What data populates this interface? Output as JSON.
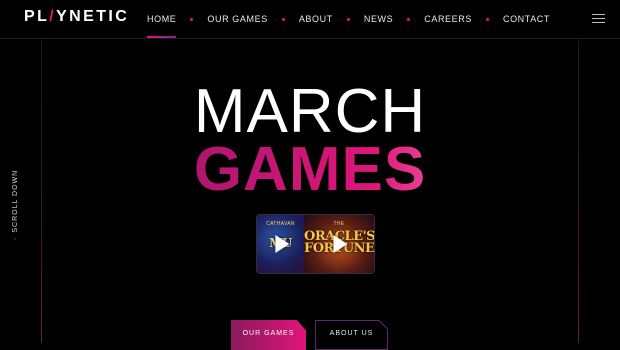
{
  "brand": {
    "logo_before": "PL",
    "logo_accent": "/",
    "logo_after": "YNETIC"
  },
  "nav": {
    "items": [
      {
        "label": "HOME",
        "active": true
      },
      {
        "label": "OUR GAMES",
        "active": false
      },
      {
        "label": "ABOUT",
        "active": false
      },
      {
        "label": "NEWS",
        "active": false
      },
      {
        "label": "CAREERS",
        "active": false
      },
      {
        "label": "CONTACT",
        "active": false
      }
    ],
    "menu_icon": "hamburger-menu-icon"
  },
  "sidebar": {
    "scroll_label": "SCROLL DOWN",
    "scroll_icon": "arrow-down-icon"
  },
  "hero": {
    "line1": "MARCH",
    "line2": "GAMES",
    "games": [
      {
        "title": "MU",
        "subtitle": "CATHAVAN"
      },
      {
        "title": "ORACLE'S FORTUNE",
        "subtitle": "THE"
      }
    ]
  },
  "cta": {
    "primary": "OUR GAMES",
    "secondary": "ABOUT US"
  },
  "colors": {
    "accent": "#e0157a",
    "accent_dark": "#7b2a8c",
    "background": "#000000"
  }
}
